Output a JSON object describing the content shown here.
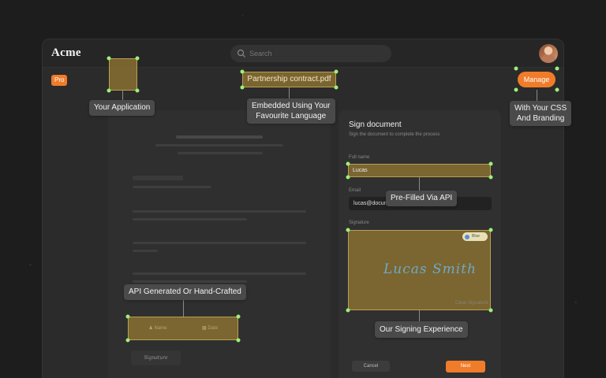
{
  "app": {
    "logo": "Acme",
    "badge": "Pro",
    "search_placeholder": "Search",
    "document_title": "Partnership contract.pdf",
    "manage_label": "Manage"
  },
  "sign_panel": {
    "title": "Sign document",
    "subtitle": "Sign the document to complete the process",
    "full_name_label": "Full name",
    "full_name_value": "Lucas",
    "email_label": "Email",
    "email_value": "lucas@docum",
    "signature_label": "Signature",
    "signature_text": "Lucas Smith",
    "pen_color": "Blue",
    "clear_label": "Clear Signature",
    "cancel_label": "Cancel",
    "next_label": "Next"
  },
  "fields": {
    "name_field": "Name",
    "date_field": "Date",
    "signature_tile": "Signature"
  },
  "callouts": {
    "your_application": "Your Application",
    "embedded_line1": "Embedded Using Your",
    "embedded_line2": "Favourite Language",
    "css_line1": "With Your CSS",
    "css_line2": "And Branding",
    "prefilled": "Pre-Filled Via API",
    "api_generated": "API Generated Or Hand-Crafted",
    "signing_experience": "Our Signing Experience"
  },
  "colors": {
    "accent": "#f07c2a",
    "highlight": "#8c7332",
    "handle": "#9cf07a"
  }
}
